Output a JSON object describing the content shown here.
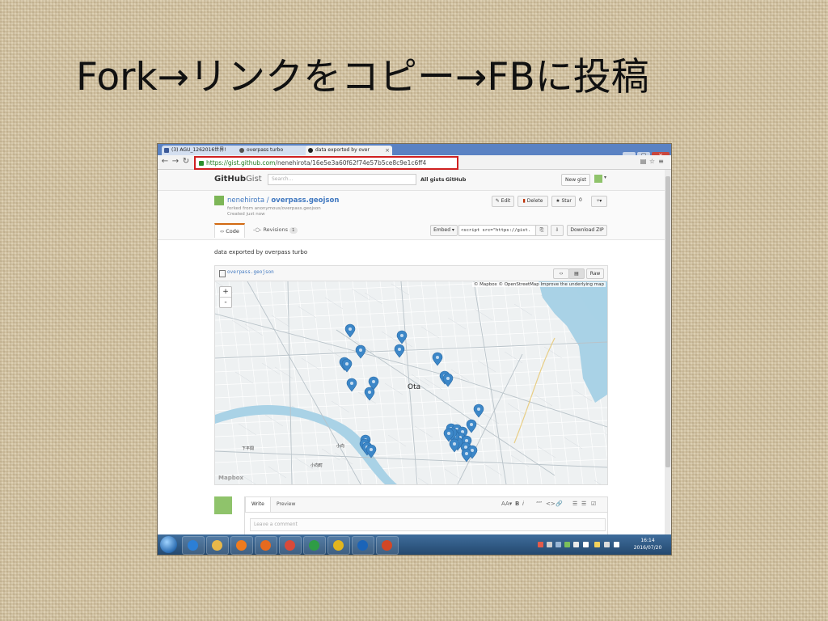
{
  "slide": {
    "title": "Fork→リンクをコピー→FBに投稿"
  },
  "browser": {
    "tabs": [
      {
        "label": "(3) AGU_1262016世界!",
        "icon": "facebook-icon",
        "icon_color": "#3b5998"
      },
      {
        "label": "overpass turbo",
        "icon": "globe-icon",
        "icon_color": "#555555"
      },
      {
        "label": "data exported by over",
        "icon": "github-icon",
        "icon_color": "#222222",
        "active": true
      }
    ],
    "url": {
      "host": "https://gist.github.com",
      "path": "/nenehirota/16e5e3a60f62f74e57b5ce8c9e1c6ff4",
      "highlight_color": "#d02020"
    }
  },
  "gist_header": {
    "logo_main": "GitHub",
    "logo_sub": "Gist",
    "search_placeholder": "Search...",
    "links": [
      "All gists",
      "GitHub"
    ],
    "new_gist": "New gist"
  },
  "repo": {
    "owner": "nenehirota",
    "separator": " / ",
    "name": "overpass.geojson",
    "forked_from": "forked from anonymous/overpass.geojson",
    "created": "Created just now",
    "edit": "Edit",
    "delete": "Delete",
    "star": "Star",
    "star_count": "0",
    "fork_icon": "fork-icon"
  },
  "tabs": {
    "code": "Code",
    "revisions": "Revisions",
    "revisions_count": "1"
  },
  "embed": {
    "label": "Embed",
    "code": "<script src=\"https://gist.",
    "download": "Download ZIP"
  },
  "content": {
    "description": "data exported by overpass turbo",
    "file_name": "overpass.geojson",
    "raw": "Raw"
  },
  "map": {
    "attribution": "© Mapbox © OpenStreetMap Improve the underlying map",
    "zoom_in": "+",
    "zoom_out": "-",
    "city": "Ota",
    "labels": [
      "下平間",
      "小向",
      "小向町"
    ],
    "logo": "Mapbox",
    "marker_color": "#3c87c8",
    "water_color": "#a9d2e6",
    "land_color": "#eef1f2",
    "marker_count": 32
  },
  "comment": {
    "write": "Write",
    "preview": "Preview",
    "placeholder": "Leave a comment",
    "tools": [
      "AA▾",
      "B",
      "i",
      "“”",
      "<>",
      "🔗",
      "☰",
      "☰",
      "☑"
    ]
  },
  "taskbar": {
    "time": "16:14",
    "date": "2016/07/20",
    "apps": [
      {
        "name": "ie-icon",
        "color": "#2c7fd6"
      },
      {
        "name": "folder-icon",
        "color": "#e8b84a"
      },
      {
        "name": "media-player-icon",
        "color": "#f07b1d"
      },
      {
        "name": "firefox-icon",
        "color": "#e66a1f"
      },
      {
        "name": "chrome-icon",
        "color": "#d94a3a"
      },
      {
        "name": "chrome-icon",
        "color": "#2f9c46"
      },
      {
        "name": "chrome-icon",
        "color": "#e2b51d"
      },
      {
        "name": "ie-icon",
        "color": "#1b64b8"
      },
      {
        "name": "powerpoint-icon",
        "color": "#d24726"
      }
    ]
  }
}
